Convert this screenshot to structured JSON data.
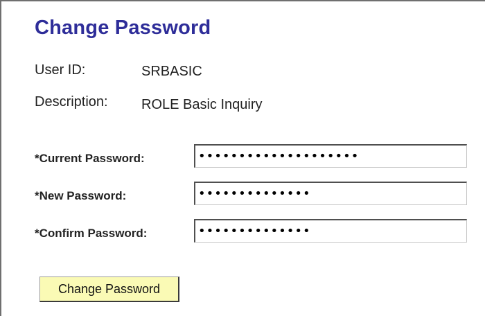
{
  "page": {
    "title": "Change Password"
  },
  "info": {
    "user_id_label": "User ID:",
    "user_id_value": "SRBASIC",
    "description_label": "Description:",
    "description_value": "ROLE Basic Inquiry"
  },
  "fields": {
    "current_label": "*Current Password:",
    "current_value": "••••••••••••••••••••",
    "new_label": "*New Password:",
    "new_value": "••••••••••••••",
    "confirm_label": "*Confirm Password:",
    "confirm_value": "••••••••••••••"
  },
  "actions": {
    "change_password_label": "Change Password"
  },
  "colors": {
    "title": "#2e2d99",
    "button_bg": "#fafab5"
  }
}
